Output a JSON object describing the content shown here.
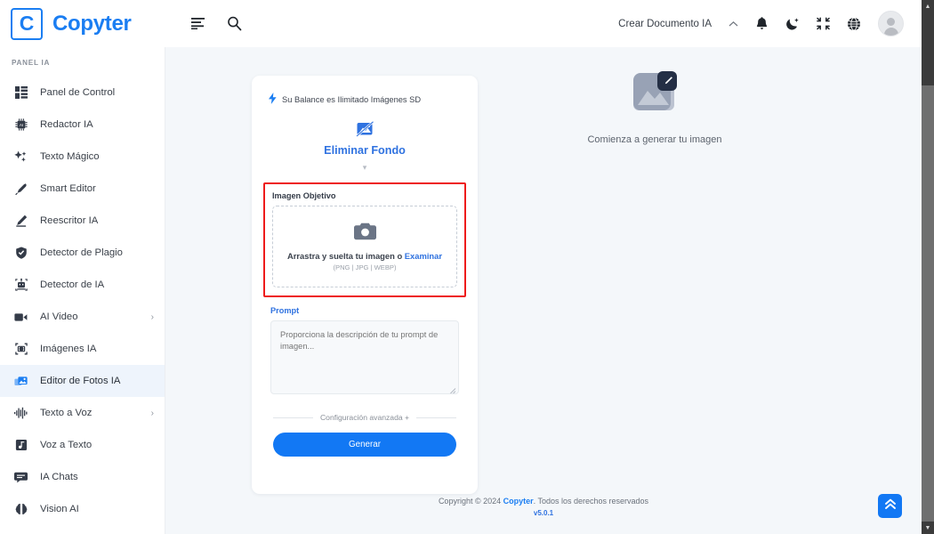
{
  "header": {
    "logo_letter": "C",
    "brand_name": "Copyter",
    "menu_icon": "menu-lines-icon",
    "search_icon": "search-icon",
    "create_doc_label": "Crear Documento IA",
    "chevron_icon": "chevron-up-icon",
    "bell_icon": "bell-icon",
    "dark_mode_icon": "moon-icon",
    "fullscreen_icon": "compress-icon",
    "language_icon": "globe-icon",
    "avatar_icon": "user-avatar"
  },
  "sidebar": {
    "section_label": "PANEL IA",
    "items": [
      {
        "label": "Panel de Control",
        "icon": "dashboard-icon",
        "caret": "",
        "active": false
      },
      {
        "label": "Redactor IA",
        "icon": "ai-chip-icon",
        "caret": "",
        "active": false
      },
      {
        "label": "Texto Mágico",
        "icon": "sparkles-icon",
        "caret": "",
        "active": false
      },
      {
        "label": "Smart Editor",
        "icon": "pen-icon",
        "caret": "",
        "active": false
      },
      {
        "label": "Reescritor IA",
        "icon": "pencil-edit-icon",
        "caret": "",
        "active": false
      },
      {
        "label": "Detector de Plagio",
        "icon": "shield-check-icon",
        "caret": "",
        "active": false
      },
      {
        "label": "Detector de IA",
        "icon": "robot-scan-icon",
        "caret": "",
        "active": false
      },
      {
        "label": "AI Video",
        "icon": "video-camera-icon",
        "caret": "›",
        "active": false
      },
      {
        "label": "Imágenes IA",
        "icon": "camera-frame-icon",
        "caret": "",
        "active": false
      },
      {
        "label": "Editor de Fotos IA",
        "icon": "photo-edit-icon",
        "caret": "",
        "active": true
      },
      {
        "label": "Texto a Voz",
        "icon": "waveform-icon",
        "caret": "›",
        "active": false
      },
      {
        "label": "Voz a Texto",
        "icon": "music-note-icon",
        "caret": "",
        "active": false
      },
      {
        "label": "IA Chats",
        "icon": "chat-bubble-icon",
        "caret": "",
        "active": false
      },
      {
        "label": "Vision AI",
        "icon": "brain-icon",
        "caret": "",
        "active": false
      }
    ]
  },
  "card": {
    "balance_icon": "lightning-bolt-icon",
    "balance_text": "Su Balance es Ilimitado Imágenes SD",
    "tool_icon": "image-remove-background-icon",
    "tool_name": "Eliminar Fondo",
    "tool_caret": "▾",
    "target_image": {
      "label": "Imagen Objetivo",
      "camera_icon": "camera-icon",
      "drop_text": "Arrastra y suelta tu imagen o",
      "browse_link": "Examinar",
      "formats": "(PNG | JPG | WEBP)",
      "highlight_color": "#ee1b1b"
    },
    "prompt": {
      "label": "Prompt",
      "placeholder": "Proporciona la descripción de tu prompt de imagen...",
      "value": ""
    },
    "advanced_label": "Configuración avanzada +",
    "generate_label": "Generar",
    "accent_color": "#1278f4"
  },
  "preview": {
    "icon": "image-edit-placeholder-icon",
    "text": "Comienza a generar tu imagen"
  },
  "footer": {
    "copyright_prefix": "Copyright © 2024",
    "brand": "Copyter",
    "copyright_suffix": ". Todos los derechos reservados",
    "version": "v5.0.1"
  },
  "scroll_top_button": {
    "icon": "double-chevron-up-icon"
  },
  "scrollbar": {
    "up_arrow": "▲",
    "down_arrow": "▼"
  }
}
